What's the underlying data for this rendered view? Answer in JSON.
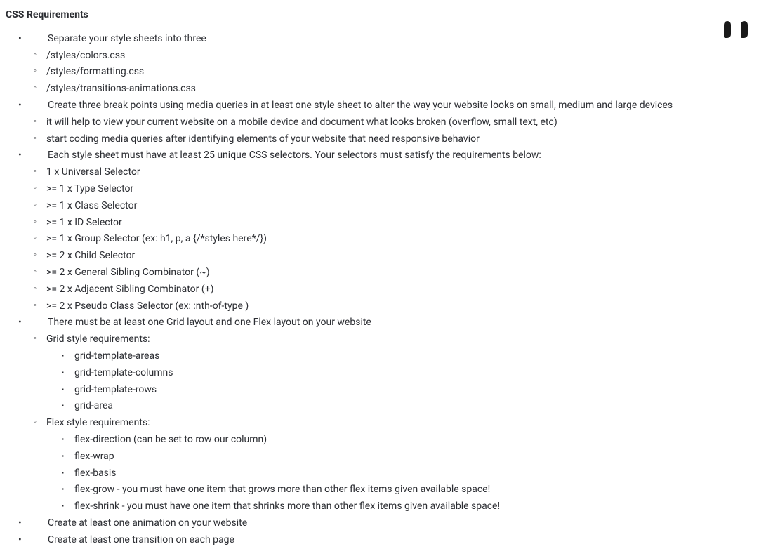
{
  "heading": "CSS Requirements",
  "items": [
    {
      "text": "Separate your style sheets into three",
      "children": [
        {
          "text": "/styles/colors.css"
        },
        {
          "text": "/styles/formatting.css"
        },
        {
          "text": "/styles/transitions-animations.css"
        }
      ]
    },
    {
      "text": "Create three break points using media queries in at least one style sheet to alter the way your website looks on small, medium and large devices",
      "children": [
        {
          "text": "it will help to view your current website on a mobile device and document what looks broken (overflow, small text, etc)"
        },
        {
          "text": "start coding media queries after identifying elements of your website that need responsive behavior"
        }
      ]
    },
    {
      "text": "Each style sheet must have at least 25 unique CSS selectors. Your selectors must satisfy the requirements below:",
      "children": [
        {
          "text": "1 x Universal Selector"
        },
        {
          "text": ">= 1 x Type Selector"
        },
        {
          "text": ">= 1 x Class Selector"
        },
        {
          "text": ">= 1 x ID Selector"
        },
        {
          "text": ">= 1 x Group Selector (ex: h1, p, a {/*styles here*/})"
        },
        {
          "text": ">= 2 x Child Selector"
        },
        {
          "text": ">= 2 x General Sibling Combinator (~)"
        },
        {
          "text": ">= 2 x Adjacent Sibling Combinator (+)"
        },
        {
          "text": ">= 2 x Pseudo Class Selector (ex: :nth-of-type )"
        }
      ]
    },
    {
      "text": "There must be at least one Grid layout and one Flex layout on your website",
      "children": [
        {
          "text": "Grid style requirements:",
          "children": [
            {
              "text": "grid-template-areas"
            },
            {
              "text": "grid-template-columns"
            },
            {
              "text": "grid-template-rows"
            },
            {
              "text": "grid-area"
            }
          ]
        },
        {
          "text": "Flex style requirements:",
          "children": [
            {
              "text": "flex-direction (can be set to row our column)"
            },
            {
              "text": "flex-wrap"
            },
            {
              "text": "flex-basis"
            },
            {
              "text": "flex-grow - you must have one item that grows more than other flex items given available space!"
            },
            {
              "text": "flex-shrink - you must have one item that shrinks more than other flex items given available space!"
            }
          ]
        }
      ]
    },
    {
      "text": "Create at least one animation on your website"
    },
    {
      "text": "Create at least one transition on each page"
    }
  ]
}
